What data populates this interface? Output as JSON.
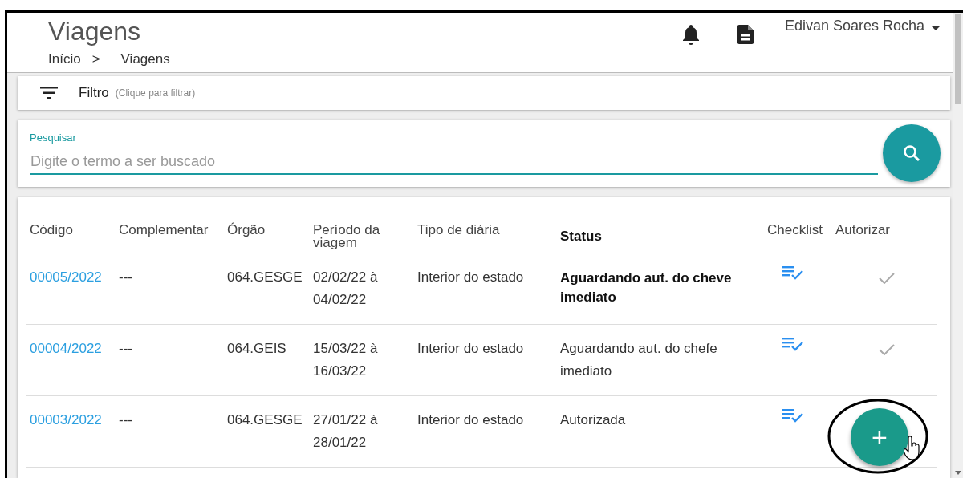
{
  "header": {
    "title": "Viagens",
    "breadcrumb": {
      "items": [
        "Início",
        "Viagens"
      ],
      "separator": ">"
    },
    "user": {
      "name": "Edivan Soares Rocha"
    }
  },
  "filter": {
    "label": "Filtro",
    "hint": "(Clique para filtrar)"
  },
  "search": {
    "label": "Pesquisar",
    "placeholder": "Digite o termo a ser buscado",
    "focused": true
  },
  "table": {
    "columns": [
      {
        "label": "Código",
        "emphasized": false
      },
      {
        "label": "Complementar",
        "emphasized": false
      },
      {
        "label": "Órgão",
        "emphasized": false
      },
      {
        "label": "Período da viagem",
        "emphasized": false
      },
      {
        "label": "Tipo de diária",
        "emphasized": false
      },
      {
        "label": "Status",
        "emphasized": true
      },
      {
        "label": "Checklist",
        "emphasized": false
      },
      {
        "label": "Autorizar",
        "emphasized": false
      }
    ],
    "rows": [
      {
        "cells": [
          "00005/2022",
          "---",
          "064.GESGE",
          "02/02/22 à 04/02/22",
          "Interior do estado",
          "Aguardando aut. do cheve imediato"
        ],
        "status_emphasized": true,
        "checklist": true,
        "authorize": true
      },
      {
        "cells": [
          "00004/2022",
          "---",
          "064.GEIS",
          "15/03/22 à 16/03/22",
          "Interior do estado",
          "Aguardando aut. do chefe imediato"
        ],
        "status_emphasized": false,
        "checklist": true,
        "authorize": true
      },
      {
        "cells": [
          "00003/2022",
          "---",
          "064.GESGE",
          "27/01/22 à 28/01/22",
          "Interior do estado",
          "Autorizada"
        ],
        "status_emphasized": false,
        "checklist": true,
        "authorize": false
      }
    ]
  },
  "fab": {
    "symbol": "+"
  }
}
